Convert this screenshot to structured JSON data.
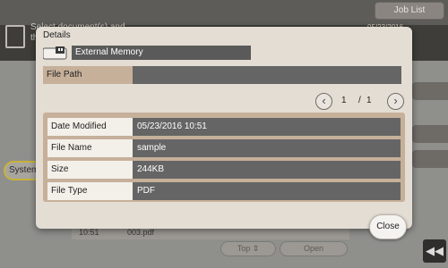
{
  "background": {
    "job_list_label": "Job List",
    "instruction_text": "Select document(s) and then ch",
    "date_text": "05/23/2016",
    "system_label": "System",
    "file_row_time": "10:51",
    "file_row_name": "003.pdf",
    "top_label": "Top",
    "open_label": "Open"
  },
  "dialog": {
    "title": "Details",
    "memory_label": "External Memory",
    "file_path_label": "File Path",
    "file_path_value": "",
    "pagination": {
      "current": "1",
      "separator": "/",
      "total": "1"
    },
    "rows": [
      {
        "label": "Date Modified",
        "value": "05/23/2016 10:51"
      },
      {
        "label": "File Name",
        "value": "sample"
      },
      {
        "label": "Size",
        "value": "244KB"
      },
      {
        "label": "File Type",
        "value": "PDF"
      }
    ],
    "close_label": "Close"
  },
  "icons": {
    "prev": "chevron-left-icon",
    "next": "chevron-right-icon",
    "memory": "usb-memory-icon",
    "document": "document-icon",
    "collapse": "double-chevron-left-icon"
  }
}
